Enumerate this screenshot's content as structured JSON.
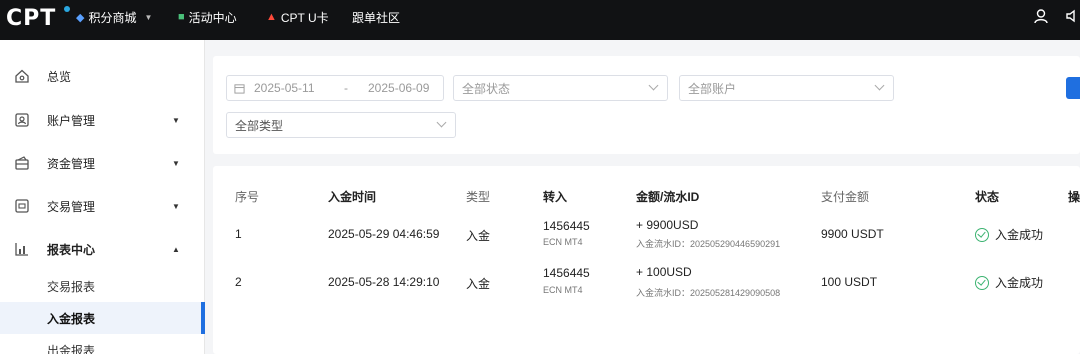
{
  "topbar": {
    "logo": "CPT",
    "nav": [
      {
        "icon": "diamond-icon",
        "label": "积分商城",
        "has_caret": true
      },
      {
        "icon": "gift-icon",
        "label": "活动中心"
      },
      {
        "icon": "fire-icon",
        "label": "CPT U卡"
      },
      {
        "icon": "",
        "label": "跟单社区"
      }
    ],
    "right_icons": [
      "user-icon",
      "speaker-icon"
    ]
  },
  "sidebar": {
    "items": [
      {
        "icon": "home-icon",
        "label": "总览"
      },
      {
        "icon": "account-icon",
        "label": "账户管理",
        "arrow": "▼"
      },
      {
        "icon": "wallet-icon",
        "label": "资金管理",
        "arrow": "▼"
      },
      {
        "icon": "trade-icon",
        "label": "交易管理",
        "arrow": "▼"
      },
      {
        "icon": "chart-icon",
        "label": "报表中心",
        "arrow": "▲"
      }
    ],
    "sub_items": [
      {
        "label": "交易报表"
      },
      {
        "label": "入金报表",
        "active": true
      },
      {
        "label": "出金报表"
      }
    ]
  },
  "filter": {
    "date_start": "2025-05-11",
    "date_sep": "-",
    "date_end": "2025-06-09",
    "status_placeholder": "全部状态",
    "account_placeholder": "全部账户",
    "type_placeholder": "全部类型"
  },
  "table": {
    "headers": [
      "序号",
      "入金时间",
      "类型",
      "转入",
      "金额/流水ID",
      "支付金额",
      "状态",
      "操"
    ],
    "rows": [
      {
        "index": "1",
        "time": "2025-05-29 04:46:59",
        "type": "入金",
        "account": "1456445",
        "account_sub": "ECN  MT4",
        "amount": "+ 9900USD",
        "flow_id": "入金流水ID：202505290446590291",
        "pay": "9900 USDT",
        "status": "入金成功"
      },
      {
        "index": "2",
        "time": "2025-05-28 14:29:10",
        "type": "入金",
        "account": "1456445",
        "account_sub": "ECN  MT4",
        "amount": "+ 100USD",
        "flow_id": "入金流水ID：202505281429090508",
        "pay": "100 USDT",
        "status": "入金成功"
      }
    ]
  },
  "colors": {
    "accent": "#1f6fe0",
    "success": "#3cb371",
    "topbar": "#111214"
  }
}
